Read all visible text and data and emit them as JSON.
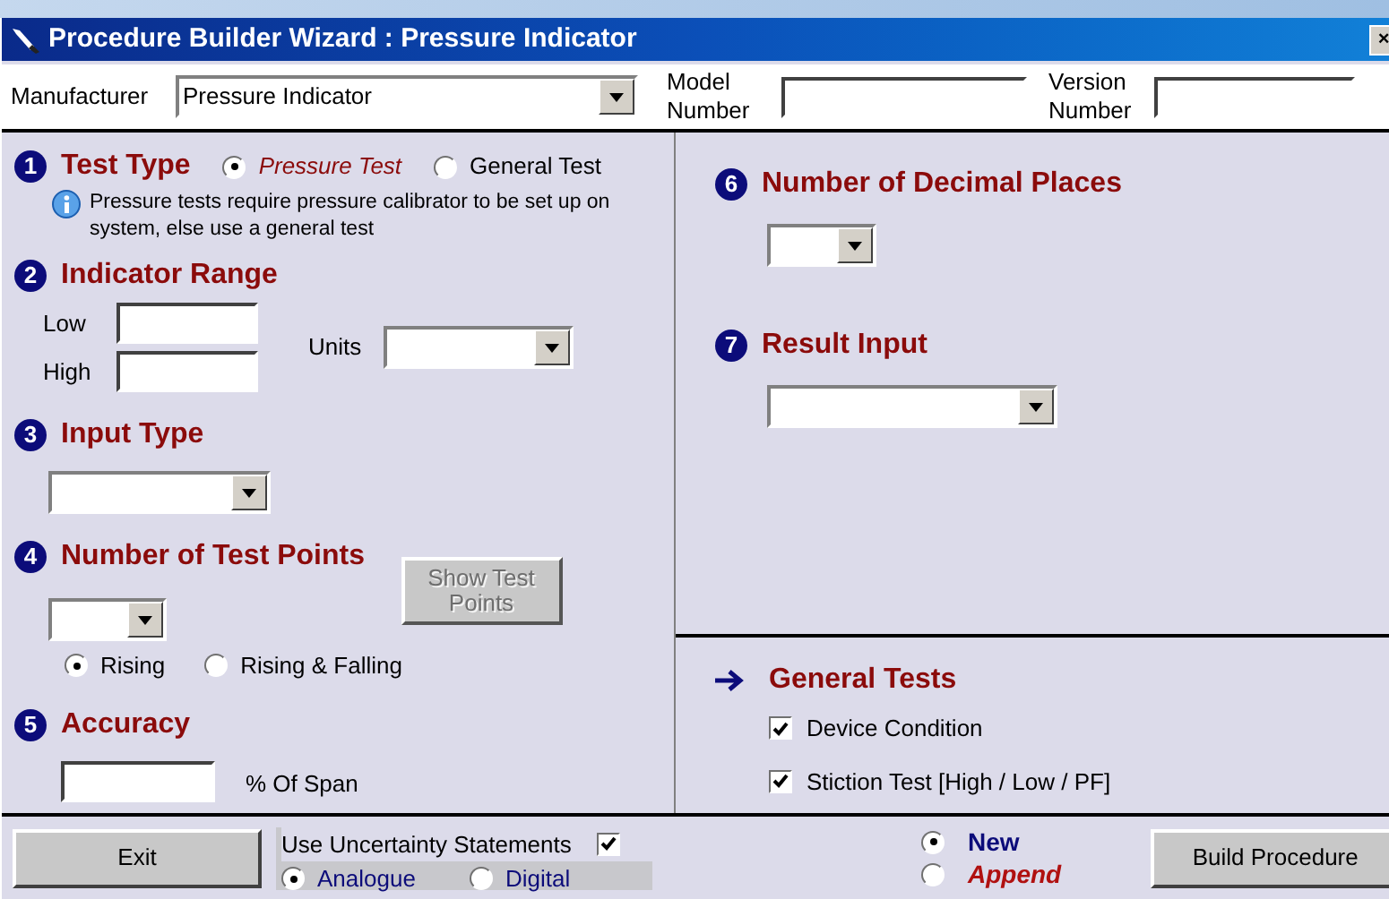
{
  "window": {
    "title": "Procedure Builder Wizard : Pressure Indicator",
    "close": "×"
  },
  "header": {
    "manufacturer": {
      "label": "Manufacturer",
      "value": "Pressure Indicator"
    },
    "model": {
      "label": "Model Number"
    },
    "version": {
      "label": "Version Number"
    }
  },
  "test_type": {
    "number": "1",
    "title": "Test Type",
    "options": [
      {
        "label": "Pressure Test",
        "selected": true
      },
      {
        "label": "General Test",
        "selected": false
      }
    ],
    "info": "Pressure tests require pressure calibrator to be set up on system, else use a general test"
  },
  "indicator_range": {
    "number": "2",
    "title": "Indicator Range",
    "low_label": "Low",
    "high_label": "High",
    "units_label": "Units"
  },
  "input_type": {
    "number": "3",
    "title": "Input Type"
  },
  "test_points": {
    "number": "4",
    "title": "Number of Test Points",
    "button": {
      "label": "Show Test Points",
      "disabled": true
    },
    "options": [
      {
        "label": "Rising",
        "selected": true
      },
      {
        "label": "Rising & Falling",
        "selected": false
      }
    ]
  },
  "accuracy": {
    "number": "5",
    "title": "Accuracy",
    "suffix": "% Of Span"
  },
  "decimal_places": {
    "number": "6",
    "title": "Number of Decimal Places"
  },
  "result_input": {
    "number": "7",
    "title": "Result Input"
  },
  "general_tests": {
    "title": "General Tests",
    "checks": [
      {
        "label": "Device Condition",
        "checked": true
      },
      {
        "label": "Stiction Test [High / Low / PF]",
        "checked": true
      }
    ]
  },
  "footer": {
    "exit": "Exit",
    "uncertainty": {
      "label": "Use Uncertainty Statements",
      "checked": true,
      "options": [
        {
          "label": "Analogue",
          "selected": true
        },
        {
          "label": "Digital",
          "selected": false
        }
      ]
    },
    "mode": [
      {
        "label": "New",
        "selected": true
      },
      {
        "label": "Append",
        "selected": false
      }
    ],
    "build": "Build Procedure"
  }
}
